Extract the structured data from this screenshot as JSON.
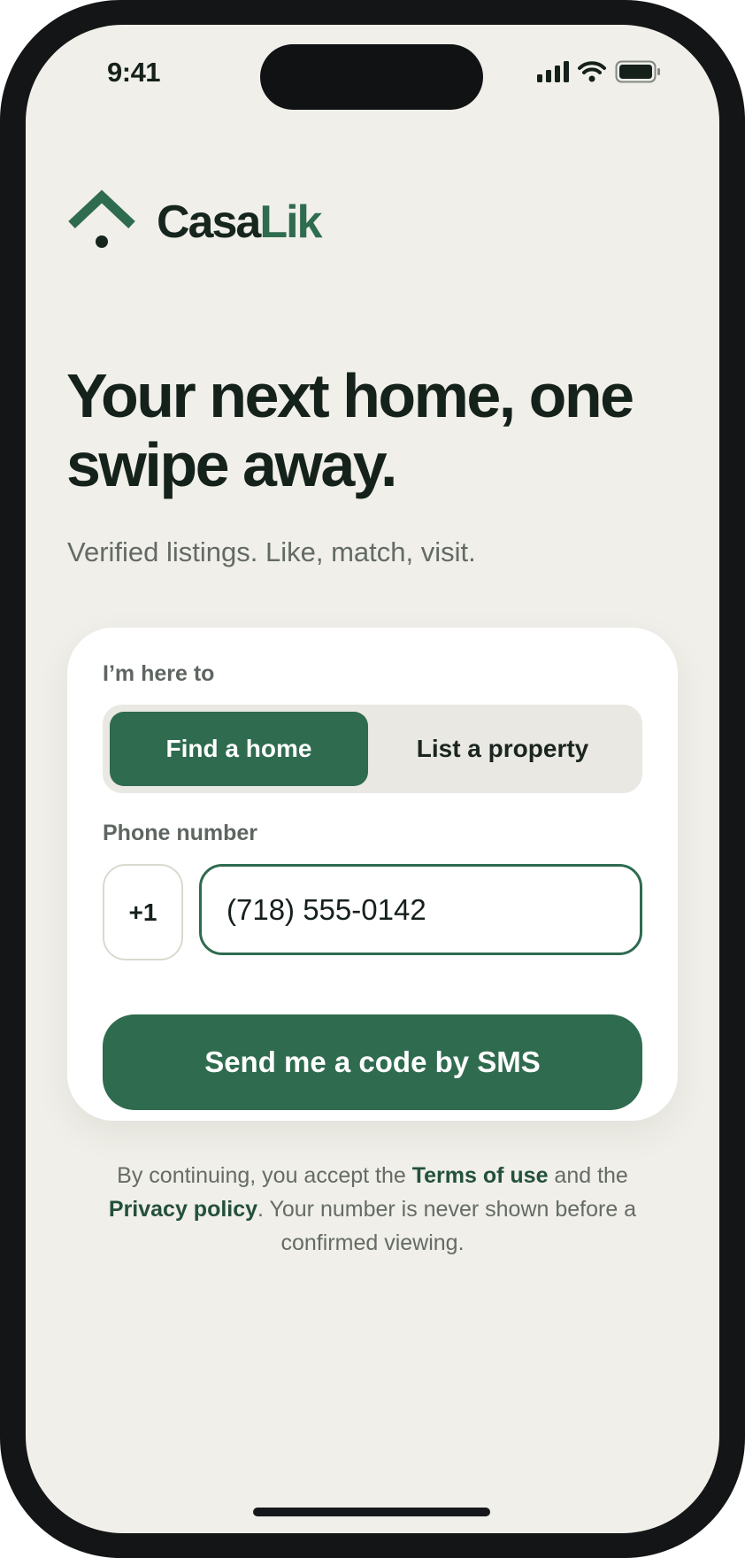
{
  "status_bar": {
    "time": "9:41",
    "icons": [
      "cellular-signal-icon",
      "wifi-icon",
      "battery-icon"
    ]
  },
  "brand": {
    "name_part1": "Casa",
    "name_part2": "Lik",
    "logo_icon": "house-roof-pin-icon",
    "dark_color": "#16251d",
    "accent_color": "#2f6b4f"
  },
  "hero": {
    "headline": "Your next home, one swipe away.",
    "subheadline": "Verified listings. Like, match, visit."
  },
  "form": {
    "intent_label": "I’m here to",
    "intent_options": [
      {
        "label": "Find a home",
        "selected": true
      },
      {
        "label": "List a property",
        "selected": false
      }
    ],
    "phone_label": "Phone number",
    "country_code": "+1",
    "phone_value": "(718) 555-0142",
    "submit_label": "Send me a code by SMS"
  },
  "legal": {
    "prefix": "By continuing, you accept the ",
    "terms_link": "Terms of use",
    "middle": " and the ",
    "privacy_link": "Privacy policy",
    "suffix": ". Your number is never shown before a confirmed viewing."
  },
  "colors": {
    "screen_background": "#f0efe9",
    "card_background": "#ffffff",
    "primary_green": "#2f6b4f",
    "device_frame": "#131516"
  }
}
